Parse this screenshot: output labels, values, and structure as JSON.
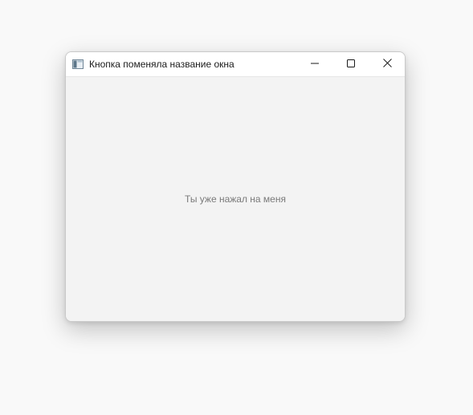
{
  "window": {
    "title": "Кнопка поменяла название окна"
  },
  "titlebar": {
    "app_icon": "window-app-icon",
    "minimize_icon": "minimize-icon",
    "maximize_icon": "maximize-icon",
    "close_icon": "close-icon"
  },
  "content": {
    "button_label": "Ты уже нажал на меня",
    "button_state": "disabled"
  },
  "colors": {
    "desktop": "#f9f9f9",
    "titlebar": "#ffffff",
    "client_area": "#f3f3f3",
    "disabled_text": "#7a7a7a"
  }
}
